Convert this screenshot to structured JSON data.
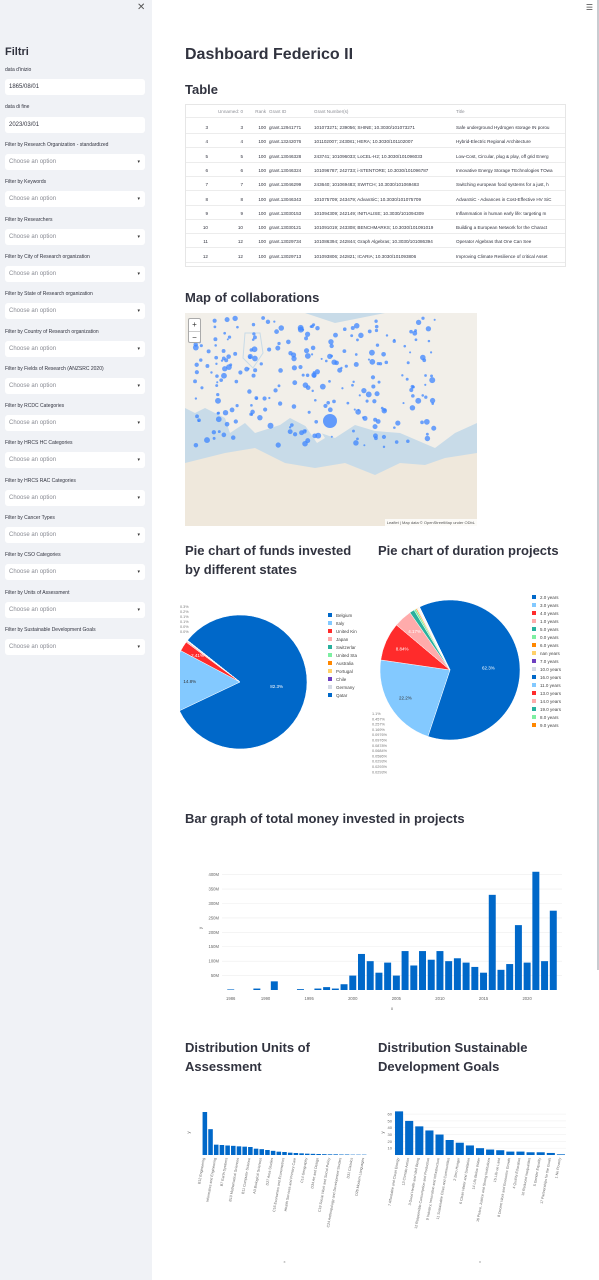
{
  "sidebar": {
    "title": "Filtri",
    "start_label": "data d'inizio",
    "start_value": "1865/08/01",
    "end_label": "data di fine",
    "end_value": "2023/03/01",
    "filters": [
      {
        "label": "Filter by Research Organization - standardized",
        "placeholder": "Choose an option"
      },
      {
        "label": "Filter by Keywords",
        "placeholder": "Choose an option"
      },
      {
        "label": "Filter by Researchers",
        "placeholder": "Choose an option"
      },
      {
        "label": "Filter by City of Research organization",
        "placeholder": "Choose an option"
      },
      {
        "label": "Filter by State of Research organization",
        "placeholder": "Choose an option"
      },
      {
        "label": "Filter by Country of Research organization",
        "placeholder": "Choose an option"
      },
      {
        "label": "Filter by Fields of Research (ANZSRC 2020)",
        "placeholder": "Choose an option"
      },
      {
        "label": "Filter by RCDC Categories",
        "placeholder": "Choose an option"
      },
      {
        "label": "Filter by HRCS HC Categories",
        "placeholder": "Choose an option"
      },
      {
        "label": "Filter by HRCS RAC Categories",
        "placeholder": "Choose an option"
      },
      {
        "label": "Filter by Cancer Types",
        "placeholder": "Choose an option"
      },
      {
        "label": "Filter by CSO Categories",
        "placeholder": "Choose an option"
      },
      {
        "label": "Filter by Units of Assessment",
        "placeholder": "Choose an option"
      },
      {
        "label": "Filter by Sustainable Development Goals",
        "placeholder": "Choose an option"
      }
    ]
  },
  "main": {
    "title": "Dashboard Federico II",
    "table_heading": "Table",
    "map_heading": "Map of collaborations",
    "pie1_heading": "Pie chart of funds invested by different states",
    "pie2_heading": "Pie chart of duration projects",
    "bar_heading": "Bar graph of total money invested in projects",
    "uoa_heading": "Distribution Units of Assessment",
    "sdg_heading": "Distribution Sustainable Development Goals",
    "map_attribution": "Leaflet | Map data © OpenStreetMap under ODbL"
  },
  "table": {
    "columns": [
      "",
      "Unnamed: 0",
      "Rank",
      "Grant ID",
      "Grant Number(s)",
      "Title"
    ],
    "rows": [
      [
        "3",
        "3",
        "100",
        "grant.12941771",
        "101073271; 239056; SHINE; 10.3030/101073271",
        "Safe underground Hydrogen storage IN porou"
      ],
      [
        "4",
        "4",
        "100",
        "grant.13242076",
        "101102007; 243081; HERA; 10.3030/101102007",
        "Hybrid-Electric Regional Architecture"
      ],
      [
        "5",
        "5",
        "100",
        "grant.13046328",
        "243741; 101096033; LoCEL-H2; 10.3030/101096033",
        "Low-Cost, Circular, plug & play, off grid Energ"
      ],
      [
        "6",
        "6",
        "100",
        "grant.13046324",
        "101096787; 242733; i-STENTORE; 10.3030/101096787",
        "Innovative Energy Storage TEchnologies TOwa"
      ],
      [
        "7",
        "7",
        "100",
        "grant.13046299",
        "243640; 101069483; SWITCH; 10.3030/101069483",
        "Switching european food systems for a just, h"
      ],
      [
        "8",
        "8",
        "100",
        "grant.13046343",
        "101075709; 243479; AdvanSiC; 10.3030/101075709",
        "AdvanSiC - Advances in Cost-Effective HV SiC"
      ],
      [
        "9",
        "9",
        "100",
        "grant.13030153",
        "101094309; 242149; INITIALISE; 10.3030/101094309",
        "Inflammation in human early life: targeting m"
      ],
      [
        "10",
        "10",
        "100",
        "grant.13030121",
        "101091019; 243308; BENCHMARKS; 10.3030/101091019",
        "Building a European Network for the Charact"
      ],
      [
        "11",
        "12",
        "100",
        "grant.13029734",
        "101086394; 242844; Graph Algebras; 10.3030/101086394",
        "Operator Algebras that One Can See"
      ],
      [
        "12",
        "12",
        "100",
        "grant.13029713",
        "101093806; 242821; ICARIA; 10.3030/101093806",
        "Improving Climate Resilience of critical Asset"
      ]
    ]
  },
  "pie1": {
    "legend": [
      "Belgium",
      "Italy",
      "United Kin",
      "Japan",
      "Switzerlar",
      "United Sta",
      "Australia",
      "Portugal",
      "Chile",
      "Germany",
      "Qatar"
    ],
    "colors": [
      "#0068c9",
      "#83c9ff",
      "#ff2b2b",
      "#ffabab",
      "#29b09d",
      "#7defa1",
      "#ff8700",
      "#ffd16a",
      "#6d3fc0",
      "#d5dae5",
      "#0068c9"
    ],
    "values": [
      82.3,
      14.8,
      2.4,
      0.3,
      0.1,
      0.05,
      0.03,
      0.02,
      0.01,
      0.01,
      0.01
    ],
    "slice_labels": [
      "82.3%",
      "14.8%",
      "2.41%"
    ],
    "tiny_labels": [
      "0.3%",
      "0.2%",
      "0.1%",
      "0.1%",
      "0.0%",
      "0.0%"
    ]
  },
  "pie2": {
    "legend": [
      "2.0 years",
      "3.0 years",
      "4.0 years",
      "1.0 years",
      "5.0 years",
      "0.0 years",
      "6.0 years",
      "nan years",
      "7.0 years",
      "10.0 years",
      "16.0 years",
      "11.0 years",
      "13.0 years",
      "14.0 years",
      "19.0 years",
      "8.0 years",
      "9.0 years"
    ],
    "colors": [
      "#0068c9",
      "#83c9ff",
      "#ff2b2b",
      "#ffabab",
      "#29b09d",
      "#7defa1",
      "#ff8700",
      "#ffd16a",
      "#6d3fc0",
      "#d5dae5",
      "#0068c9",
      "#83c9ff",
      "#ff2b2b",
      "#ffabab",
      "#29b09d",
      "#7defa1",
      "#ff8700"
    ],
    "values": [
      62.3,
      22.2,
      8.84,
      4.17,
      1.1,
      0.46,
      0.25,
      0.17,
      0.1,
      0.1,
      0.09,
      0.07,
      0.06,
      0.05,
      0.03,
      0.03,
      0.03
    ],
    "slice_labels": [
      "62.3%",
      "22.2%",
      "8.84%",
      "4.17%"
    ],
    "tiny_labels": [
      "1.1%",
      "0.457%",
      "0.257%",
      "0.169%",
      "0.0976%",
      "0.0976%",
      "0.0878%",
      "0.0684%",
      "0.0586%",
      "0.0293%",
      "0.0293%",
      "0.0293%"
    ]
  },
  "chart_data": [
    {
      "type": "bar",
      "title": "Bar graph of total money invested in projects",
      "xlabel": "x",
      "ylabel": "y",
      "x": [
        1986,
        1989,
        1991,
        1994,
        1996,
        1997,
        1998,
        1999,
        2000,
        2001,
        2002,
        2003,
        2004,
        2005,
        2006,
        2007,
        2008,
        2009,
        2010,
        2011,
        2012,
        2013,
        2014,
        2015,
        2016,
        2017,
        2018,
        2019,
        2020,
        2021,
        2022,
        2023
      ],
      "values": [
        2,
        5,
        30,
        3,
        5,
        10,
        5,
        20,
        50,
        125,
        100,
        60,
        95,
        50,
        135,
        85,
        135,
        105,
        135,
        100,
        110,
        95,
        80,
        60,
        330,
        70,
        90,
        225,
        95,
        410,
        100,
        275
      ],
      "yticks": [
        "50M",
        "100M",
        "150M",
        "200M",
        "250M",
        "300M",
        "350M",
        "400M"
      ],
      "xticks": [
        "1990",
        "1995",
        "2000",
        "2005",
        "2010",
        "2015",
        "2020"
      ],
      "ylim": [
        0,
        430
      ]
    },
    {
      "type": "bar",
      "title": "Distribution Units of Assessment",
      "xlabel": "x",
      "ylabel": "y",
      "categories": [
        "B12 Engineering",
        "B8 Agriculture, Food & Veterinary",
        "Informatics and Engineering",
        "A5 Allied Health Professions",
        "B7 Earth Systems",
        "B9 Physics",
        "B10 Mathematical Sciences",
        "C17 Architecture",
        "B11 Computer Science",
        "D28 Business and Management Studies",
        "A3 Biological Sciences",
        "B13 Chemistry",
        "D27 Area Studies",
        "D30 Archaeology",
        "C16 Economics and Econometrics",
        "D32 Philosophy",
        "Health Services and Primary Care",
        "A4 Psychology, Psychiatry",
        "C14 Geography",
        "Library and Information Management",
        "D34 Art and Design",
        "C18 Law",
        "C19 Social Work and Social Policy",
        "C20 Sociology",
        "C24 Anthropology and Development Studies",
        "D33 Music",
        "D31 Classics",
        "C23 Education",
        "D26 Modern Languages"
      ],
      "values": [
        258,
        155,
        62,
        60,
        57,
        55,
        52,
        50,
        48,
        38,
        35,
        30,
        25,
        20,
        18,
        14,
        12,
        10,
        8,
        7,
        6,
        5,
        4,
        4,
        3,
        3,
        2,
        2,
        2
      ],
      "ylim": [
        0,
        270
      ]
    },
    {
      "type": "bar",
      "title": "Distribution Sustainable Development Goals",
      "xlabel": "x",
      "ylabel": "y",
      "categories": [
        "7 Affordable and Clean Energy",
        "13 Climate Action",
        "3 Good Health and Well Being",
        "12 Responsible Consumption and Production",
        "9 Industry, Innovation and Infrastructure",
        "11 Sustainable Cities and Communities",
        "2 Zero Hunger",
        "6 Clean Water and Sanitation",
        "14 Life Below Water",
        "16 Peace, Justice and Strong Institutions",
        "15 Life on Land",
        "8 Decent Work and Economic Growth",
        "4 Quality Education",
        "10 Reduced Inequalities",
        "5 Gender Equality",
        "17 Partnerships for the Goals",
        "1 No Poverty"
      ],
      "values": [
        64,
        50,
        42,
        36,
        30,
        22,
        18,
        14,
        10,
        8,
        7,
        5,
        5,
        4,
        4,
        3,
        1
      ],
      "yticks": [
        "10",
        "20",
        "30",
        "40",
        "50",
        "60"
      ],
      "ylim": [
        0,
        66
      ]
    }
  ]
}
